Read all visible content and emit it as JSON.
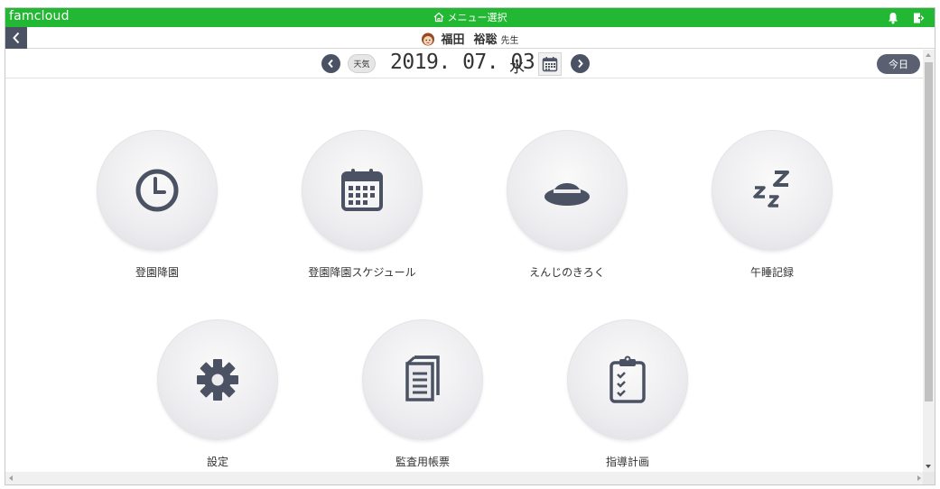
{
  "app": {
    "brand": "famcloud",
    "menu_title": "メニュー選択"
  },
  "user": {
    "name_family": "福田",
    "name_given": "裕聡",
    "honorific": "先生"
  },
  "datebar": {
    "weather_label": "天気",
    "date": "2019. 07. 03",
    "weekday": "水",
    "today_label": "今日"
  },
  "menu": [
    {
      "label": "登園降園",
      "icon": "clock-icon"
    },
    {
      "label": "登園降園スケジュール",
      "icon": "calendar-icon"
    },
    {
      "label": "えんじのきろく",
      "icon": "hat-icon"
    },
    {
      "label": "午睡記録",
      "icon": "sleep-zzz-icon"
    },
    {
      "label": "設定",
      "icon": "gear-icon"
    },
    {
      "label": "監査用帳票",
      "icon": "documents-icon"
    },
    {
      "label": "指導計画",
      "icon": "clipboard-checklist-icon"
    }
  ],
  "colors": {
    "topbar": "#22b833",
    "icon": "#4b5263",
    "tile": "#ececef"
  }
}
